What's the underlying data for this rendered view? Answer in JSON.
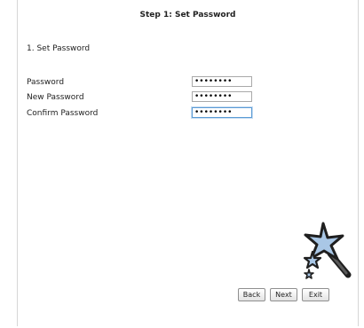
{
  "page": {
    "title": "Step 1: Set Password"
  },
  "section": {
    "heading": "1. Set Password"
  },
  "fields": [
    {
      "label": "Password",
      "value": "••••••••"
    },
    {
      "label": "New Password",
      "value": "••••••••"
    },
    {
      "label": "Confirm Password",
      "value": "••••••••"
    }
  ],
  "buttons": {
    "back": "Back",
    "next": "Next",
    "exit": "Exit"
  },
  "icons": {
    "wizard": "magic-wand-stars-icon"
  },
  "colors": {
    "star_fill": "#a9c7e6",
    "star_stroke": "#1f1f1f",
    "focus_border": "#5b9bd5"
  }
}
